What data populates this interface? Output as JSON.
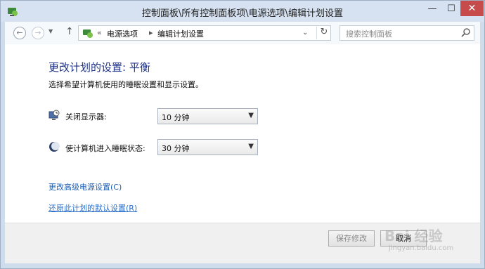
{
  "window": {
    "title": "控制面板\\所有控制面板项\\电源选项\\编辑计划设置",
    "minimize": "—",
    "maximize": "☐",
    "close": "✕"
  },
  "nav": {
    "back": "←",
    "forward": "→",
    "recent": "▼",
    "up": "↑",
    "separator": "«",
    "breadcrumbs": [
      "电源选项",
      "编辑计划设置"
    ],
    "crumb_arrow": "▸",
    "dropdown": "⌄",
    "refresh": "↻",
    "search_placeholder": "搜索控制面板"
  },
  "main": {
    "heading": "更改计划的设置: 平衡",
    "subtitle": "选择希望计算机使用的睡眠设置和显示设置。",
    "settings": [
      {
        "label": "关闭显示器:",
        "value": "10 分钟",
        "icon": "monitor-clock-icon"
      },
      {
        "label": "使计算机进入睡眠状态:",
        "value": "30 分钟",
        "icon": "sleep-moon-icon"
      }
    ],
    "links": {
      "advanced": "更改高级电源设置(C)",
      "restore": "还原此计划的默认设置(R)"
    }
  },
  "footer": {
    "save": "保存修改",
    "cancel": "取消"
  },
  "watermark": {
    "brand": "Bai 经验",
    "sub": "jingyan.baidu.com"
  },
  "colors": {
    "heading": "#1e3287",
    "link": "#1e5fb3",
    "close_button": "#c74b4b",
    "frame": "#cfdcec"
  }
}
